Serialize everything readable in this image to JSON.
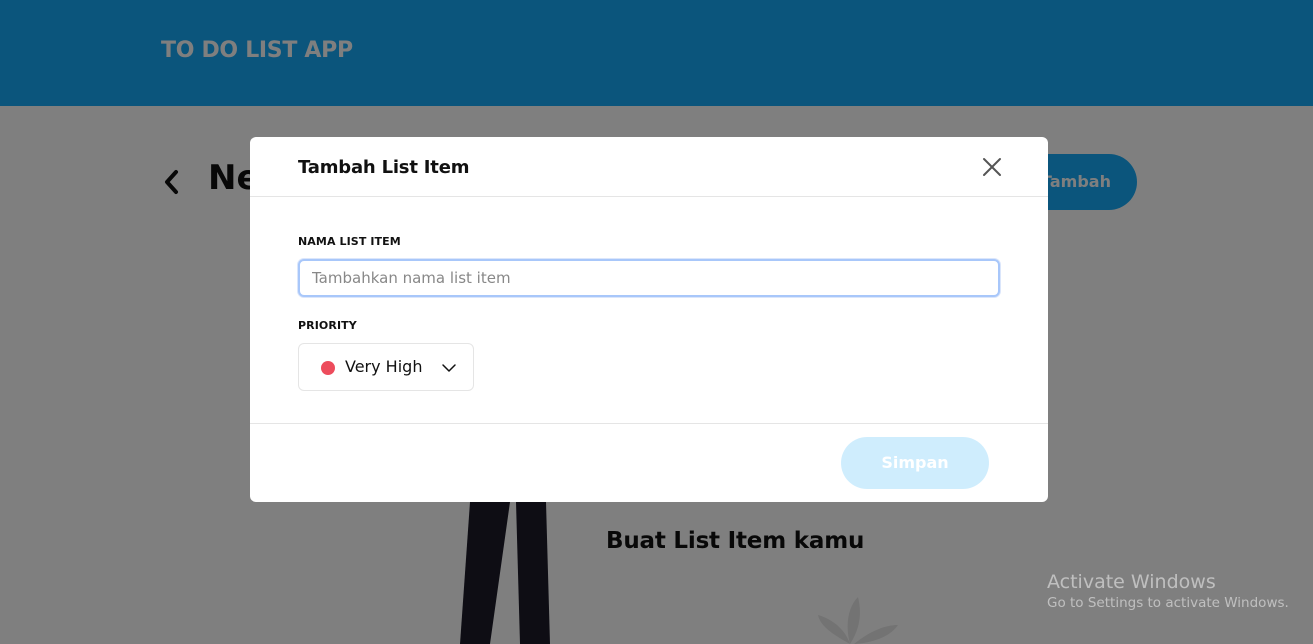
{
  "header": {
    "title": "TO DO LIST APP"
  },
  "activity": {
    "title_partial": "Ne",
    "add_button_label": "Tambah",
    "empty_state_text": "Buat List Item kamu"
  },
  "modal": {
    "title": "Tambah List Item",
    "name_field": {
      "label": "NAMA LIST ITEM",
      "placeholder": "Tambahkan nama list item",
      "value": ""
    },
    "priority_field": {
      "label": "PRIORITY",
      "selected": "Very High",
      "selected_color": "#ed4c5c"
    },
    "save_button_label": "Simpan"
  },
  "watermark": {
    "title": "Activate Windows",
    "subtitle": "Go to Settings to activate Windows."
  },
  "colors": {
    "primary": "#16abf8",
    "very_high": "#ed4c5c"
  },
  "icons": [
    "chevron-left-icon",
    "close-icon",
    "chevron-down-icon"
  ]
}
